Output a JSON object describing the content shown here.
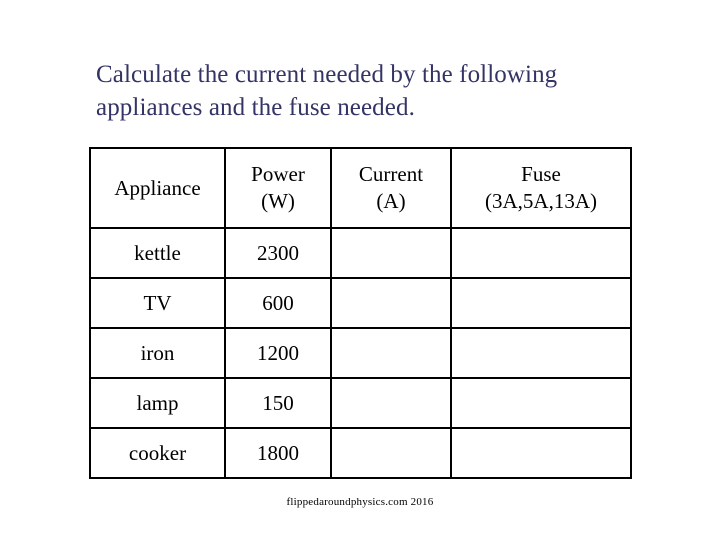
{
  "slide": {
    "background_color": "#ffffff",
    "title_color": "#333366",
    "table_border_color": "#000000"
  },
  "title": {
    "line1": "Calculate the current needed by the following",
    "line2": "appliances and the fuse needed."
  },
  "table": {
    "headers": [
      {
        "line1": "Appliance",
        "line2": ""
      },
      {
        "line1": "Power",
        "line2": "(W)"
      },
      {
        "line1": "Current",
        "line2": "(A)"
      },
      {
        "line1": "Fuse",
        "line2": "(3A,5A,13A)"
      }
    ],
    "rows": [
      {
        "appliance": "kettle",
        "power": "2300",
        "current": "",
        "fuse": ""
      },
      {
        "appliance": "TV",
        "power": "600",
        "current": "",
        "fuse": ""
      },
      {
        "appliance": "iron",
        "power": "1200",
        "current": "",
        "fuse": ""
      },
      {
        "appliance": "lamp",
        "power": "150",
        "current": "",
        "fuse": ""
      },
      {
        "appliance": "cooker",
        "power": "1800",
        "current": "",
        "fuse": ""
      }
    ]
  },
  "footer": {
    "credit": "flippedaroundphysics.com 2016"
  }
}
